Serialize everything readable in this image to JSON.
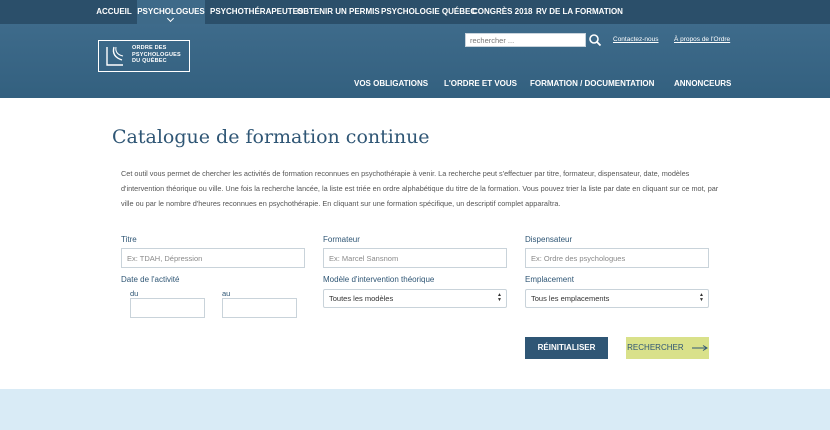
{
  "topnav": {
    "items": [
      {
        "label": "ACCUEIL"
      },
      {
        "label": "PSYCHOLOGUES"
      },
      {
        "label": "PSYCHOTHÉRAPEUTES"
      },
      {
        "label": "OBTENIR UN PERMIS"
      },
      {
        "label": "PSYCHOLOGIE QUÉBEC"
      },
      {
        "label": "CONGRÈS 2018"
      },
      {
        "label": "RV DE LA FORMATION"
      }
    ],
    "active_index": 1
  },
  "header": {
    "logo_text": [
      "ORDRE DES",
      "PSYCHOLOGUES",
      "DU QUÉBEC"
    ],
    "search_placeholder": "rechercher ...",
    "links": {
      "contact": "Contactez-nous",
      "about": "À propos de l'Ordre"
    },
    "mainnav": [
      "VOS OBLIGATIONS",
      "L'ORDRE ET VOUS",
      "FORMATION / DOCUMENTATION",
      "ANNONCEURS"
    ]
  },
  "main": {
    "title": "Catalogue de formation continue",
    "intro": "Cet outil vous permet de chercher les activités de formation reconnues en psychothérapie à venir. La recherche peut s'effectuer par titre, formateur, dispensateur, date, modèles d'intervention théorique ou ville. Une fois la recherche lancée, la liste est triée en ordre alphabétique du titre de la formation. Vous pouvez trier la liste par date en cliquant sur ce mot, par ville ou par le nombre d'heures reconnues en psychothérapie. En cliquant sur une formation spécifique, un descriptif complet apparaîtra."
  },
  "form": {
    "titre": {
      "label": "Titre",
      "placeholder": "Ex: TDAH, Dépression"
    },
    "formateur": {
      "label": "Formateur",
      "placeholder": "Ex: Marcel Sansnom"
    },
    "dispensateur": {
      "label": "Dispensateur",
      "placeholder": "Ex: Ordre des psychologues"
    },
    "date": {
      "label": "Date de l'activité",
      "from_label": "du",
      "to_label": "au"
    },
    "modele": {
      "label": "Modèle d'intervention théorique",
      "selected": "Toutes les modèles"
    },
    "emplacement": {
      "label": "Emplacement",
      "selected": "Tous les emplacements"
    },
    "reset_label": "RÉINITIALISER",
    "search_label": "RECHERCHER"
  },
  "colors": {
    "navy": "#2b4f6a",
    "header": "#3a6787",
    "accent": "#2f5675",
    "search_btn": "#d9e18a",
    "footer": "#d9ebf6"
  }
}
